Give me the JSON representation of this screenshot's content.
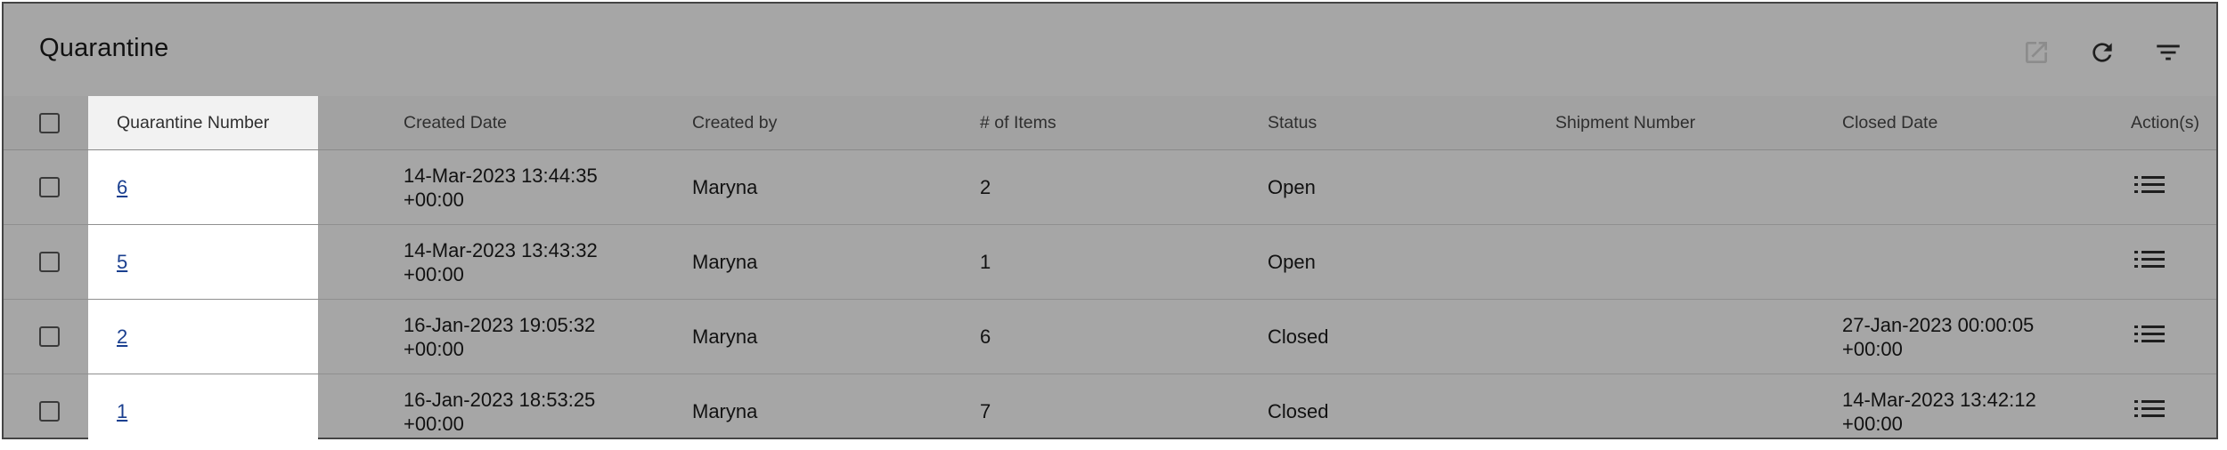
{
  "header": {
    "title": "Quarantine",
    "icons": [
      "open-in-new-icon",
      "refresh-icon",
      "filter-icon"
    ]
  },
  "table": {
    "columns": [
      "Quarantine Number",
      "Created Date",
      "Created by",
      "# of Items",
      "Status",
      "Shipment Number",
      "Closed Date",
      "Action(s)"
    ],
    "rows": [
      {
        "number": "6",
        "created_date": "14-Mar-2023 13:44:35",
        "created_tz": "+00:00",
        "created_by": "Maryna",
        "items": "2",
        "status": "Open",
        "shipment": "",
        "closed_date": "",
        "closed_tz": ""
      },
      {
        "number": "5",
        "created_date": "14-Mar-2023 13:43:32",
        "created_tz": "+00:00",
        "created_by": "Maryna",
        "items": "1",
        "status": "Open",
        "shipment": "",
        "closed_date": "",
        "closed_tz": ""
      },
      {
        "number": "2",
        "created_date": "16-Jan-2023 19:05:32",
        "created_tz": "+00:00",
        "created_by": "Maryna",
        "items": "6",
        "status": "Closed",
        "shipment": "",
        "closed_date": "27-Jan-2023 00:00:05",
        "closed_tz": "+00:00"
      },
      {
        "number": "1",
        "created_date": "16-Jan-2023 18:53:25",
        "created_tz": "+00:00",
        "created_by": "Maryna",
        "items": "7",
        "status": "Closed",
        "shipment": "",
        "closed_date": "14-Mar-2023 13:42:12",
        "closed_tz": "+00:00"
      }
    ]
  },
  "colors": {
    "overlay_bg": "#a6a6a6",
    "highlight_column": "#ffffff",
    "link": "#1a3f8f"
  }
}
